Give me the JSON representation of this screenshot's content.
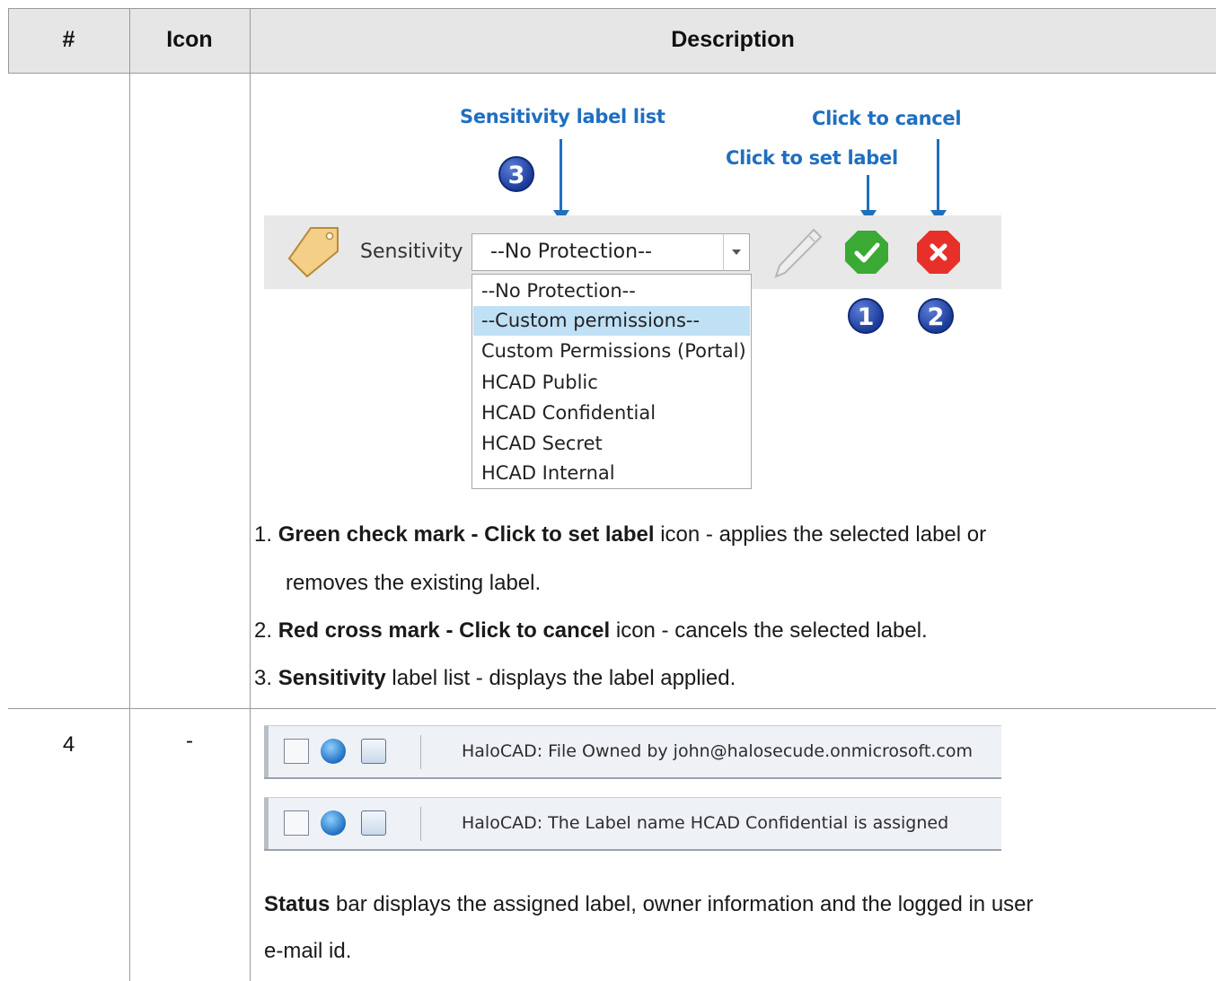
{
  "table": {
    "headers": {
      "num": "#",
      "icon": "Icon",
      "description": "Description"
    }
  },
  "row1": {
    "figure": {
      "callouts": {
        "label_list": "Sensitivity label list",
        "cancel": "Click to cancel",
        "set_label": "Click to set label"
      },
      "badges": {
        "one": "1",
        "two": "2",
        "three": "3"
      },
      "sensitivity_label": "Sensitivity",
      "combo_value": "--No Protection--",
      "dropdown_options": [
        "--No Protection--",
        "--Custom permissions--",
        "Custom Permissions (Portal)",
        "HCAD Public",
        "HCAD Confidential",
        "HCAD Secret",
        "HCAD Internal"
      ],
      "selected_option": "--Custom permissions--",
      "colors": {
        "callout": "#1f6fc0",
        "check": "#3aaa35",
        "cross": "#e8302a",
        "highlight": "#bfe0f5"
      }
    },
    "list": [
      {
        "num": "1.",
        "bold": "Green check mark - Click to set label",
        "rest": " icon - applies the selected label or",
        "cont": "removes the existing label."
      },
      {
        "num": "2.",
        "bold": "Red cross mark - Click to cancel",
        "rest": " icon - cancels the selected label."
      },
      {
        "num": "3.",
        "bold": "Sensitivity",
        "rest": " label list - displays the label applied."
      }
    ]
  },
  "row2": {
    "num": "4",
    "icon": "-",
    "statusbars": [
      "HaloCAD: File Owned by john@halosecude.onmicrosoft.com",
      "HaloCAD: The Label name HCAD Confidential is assigned"
    ],
    "desc_bold": "Status",
    "desc_rest": " bar displays the assigned label, owner information and the logged in user",
    "desc_cont": "e-mail id."
  }
}
